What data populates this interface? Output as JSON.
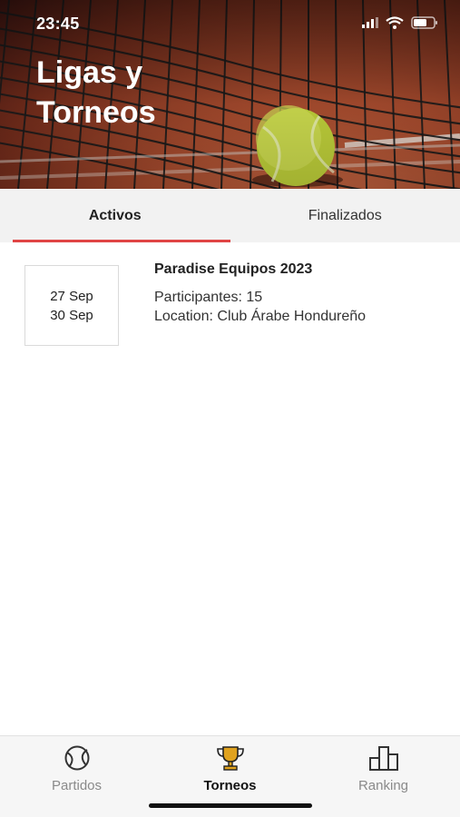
{
  "status": {
    "time": "23:45"
  },
  "header": {
    "title_line1": "Ligas y",
    "title_line2": "Torneos"
  },
  "tabs": [
    {
      "label": "Activos",
      "active": true
    },
    {
      "label": "Finalizados",
      "active": false
    }
  ],
  "tournaments": [
    {
      "start": "27 Sep",
      "end": "30 Sep",
      "title": "Paradise Equipos 2023",
      "participants": "Participantes: 15",
      "location": "Location: Club Árabe Hondureño"
    }
  ],
  "tabbar": [
    {
      "label": "Partidos",
      "icon": "tennis-ball-icon",
      "active": false
    },
    {
      "label": "Torneos",
      "icon": "trophy-icon",
      "active": true
    },
    {
      "label": "Ranking",
      "icon": "podium-icon",
      "active": false
    }
  ],
  "colors": {
    "accent": "#e04545",
    "trophy": "#e0a21e"
  }
}
